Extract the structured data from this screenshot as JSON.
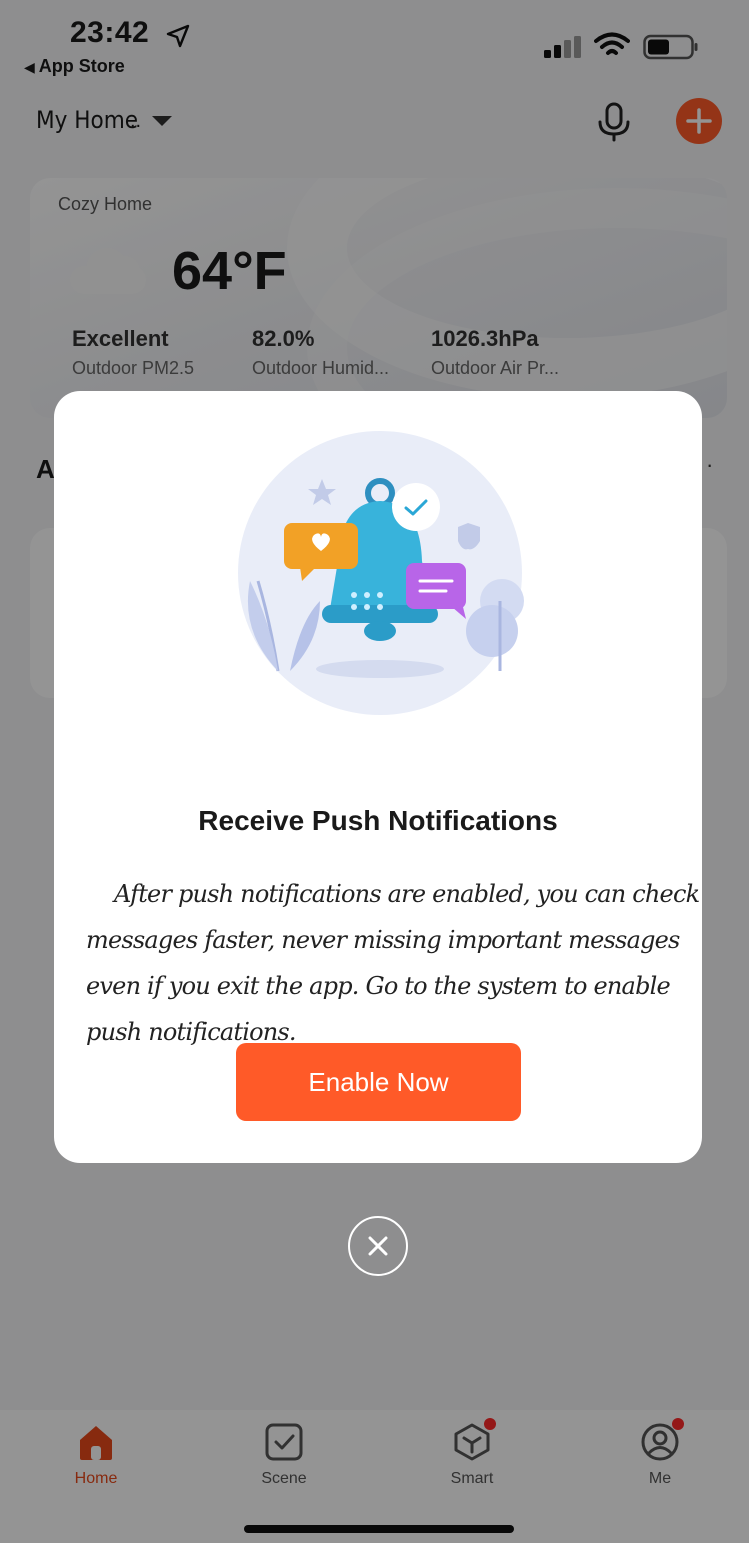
{
  "status_bar": {
    "time": "23:42",
    "back_label": "App Store"
  },
  "header": {
    "home_name": "My Home",
    "home_suffix": ".."
  },
  "weather": {
    "location": "Cozy Home",
    "temperature": "64°F",
    "metrics": [
      {
        "value": "Excellent",
        "label": "Outdoor PM2.5"
      },
      {
        "value": "82.0%",
        "label": "Outdoor Humid..."
      },
      {
        "value": "1026.3hPa",
        "label": "Outdoor Air Pr..."
      }
    ]
  },
  "section": {
    "title_initial": "A",
    "more": "·"
  },
  "modal": {
    "title": "Receive Push Notifications",
    "body": "After push notifications are enabled, you can check messages faster, never missing important messages even if you exit the app. Go to the system to enable push notifications.",
    "button": "Enable Now"
  },
  "tabs": [
    {
      "label": "Home",
      "icon": "home-icon",
      "active": true
    },
    {
      "label": "Scene",
      "icon": "scene-icon"
    },
    {
      "label": "Smart",
      "icon": "smart-icon",
      "badge": true
    },
    {
      "label": "Me",
      "icon": "profile-icon",
      "badge": true
    }
  ],
  "colors": {
    "accent": "#ff5a28",
    "active_tab": "#e8491b",
    "badge": "#ff2a2a"
  }
}
